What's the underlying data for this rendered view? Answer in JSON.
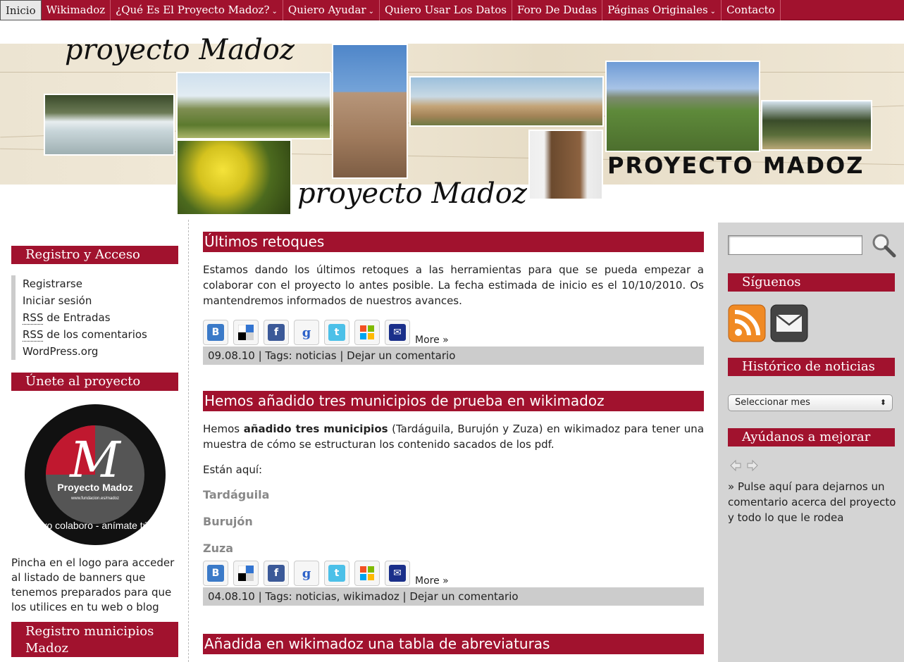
{
  "nav": {
    "items": [
      {
        "label": "Inicio",
        "dropdown": false
      },
      {
        "label": "Wikimadoz",
        "dropdown": false
      },
      {
        "label": "¿Qué Es El Proyecto Madoz?",
        "dropdown": true
      },
      {
        "label": "Quiero Ayudar",
        "dropdown": true
      },
      {
        "label": "Quiero Usar Los Datos",
        "dropdown": false
      },
      {
        "label": "Foro De Dudas",
        "dropdown": false
      },
      {
        "label": "Páginas Originales",
        "dropdown": true
      },
      {
        "label": "Contacto",
        "dropdown": false
      }
    ],
    "arrow": "»"
  },
  "header": {
    "script_title_top": "proyecto Madoz",
    "script_title_bottom": "proyecto Madoz",
    "block_title": "PROYECTO MADOZ"
  },
  "left": {
    "registro_title": "Registro y Acceso",
    "links": [
      {
        "label": "Registrarse",
        "abbr": ""
      },
      {
        "label": "Iniciar sesión",
        "abbr": ""
      },
      {
        "abbr": "RSS",
        "label": " de Entradas"
      },
      {
        "abbr": "RSS",
        "label": " de los comentarios"
      },
      {
        "label": "WordPress.org",
        "abbr": ""
      }
    ],
    "unete_title": "Únete al proyecto",
    "logo_letter": "M",
    "logo_name": "Proyecto Madoz",
    "logo_url": "www.fundacion.es/madoz",
    "logo_slogan": "yo colaboro - anímate tú",
    "logo_text": "Pincha en el logo para acceder al listado de banners que tenemos preparados para que los utilices en tu web o blog",
    "registro_municipios_title": "Registro municipios Madoz"
  },
  "posts": [
    {
      "title": "Últimos retoques",
      "body": "Estamos dando los últimos retoques a las herramientas para que se pueda empezar a colaborar con el proyecto lo antes posible. La fecha estimada de inicio es el 10/10/2010. Os mantendremos informados de nuestros avances.",
      "more": "More »",
      "meta": "09.08.10 | Tags: noticias | Dejar un comentario"
    },
    {
      "title": "Hemos añadido tres municipios de prueba en wikimadoz",
      "body_pre": "Hemos ",
      "body_bold": "añadido tres municipios",
      "body_post": " (Tardáguila, Burujón y Zuza) en wikimadoz para tener una muestra de cómo se estructuran los contenido sacados de los pdf.",
      "here": "Están aquí:",
      "municipios": [
        "Tardáguila",
        "Burujón",
        "Zuza"
      ],
      "more": "More »",
      "meta": "04.08.10 | Tags: noticias, wikimadoz | Dejar un comentario"
    },
    {
      "title": "Añadida en wikimadoz una tabla de abreviaturas"
    }
  ],
  "share_buttons": [
    {
      "name": "blogger",
      "glyph": "B",
      "color": "#3b7ac8"
    },
    {
      "name": "delicious",
      "glyph": "",
      "color": "#ffffff"
    },
    {
      "name": "facebook",
      "glyph": "f",
      "color": "#3b5998"
    },
    {
      "name": "google",
      "glyph": "g",
      "color": "#ffffff"
    },
    {
      "name": "twitter",
      "glyph": "t",
      "color": "#4cc0e8"
    },
    {
      "name": "windows-live",
      "glyph": "",
      "color": "#ffffff"
    },
    {
      "name": "email",
      "glyph": "✉",
      "color": "#1a2f8a"
    }
  ],
  "right": {
    "siguenos_title": "Síguenos",
    "historico_title": "Histórico de noticias",
    "select_value": "Seleccionar mes",
    "ayudanos_title": "Ayúdanos a mejorar",
    "ayudanos_text": "» Pulse aquí para dejarnos un comentario acerca del proyecto y todo lo que le rodea"
  }
}
